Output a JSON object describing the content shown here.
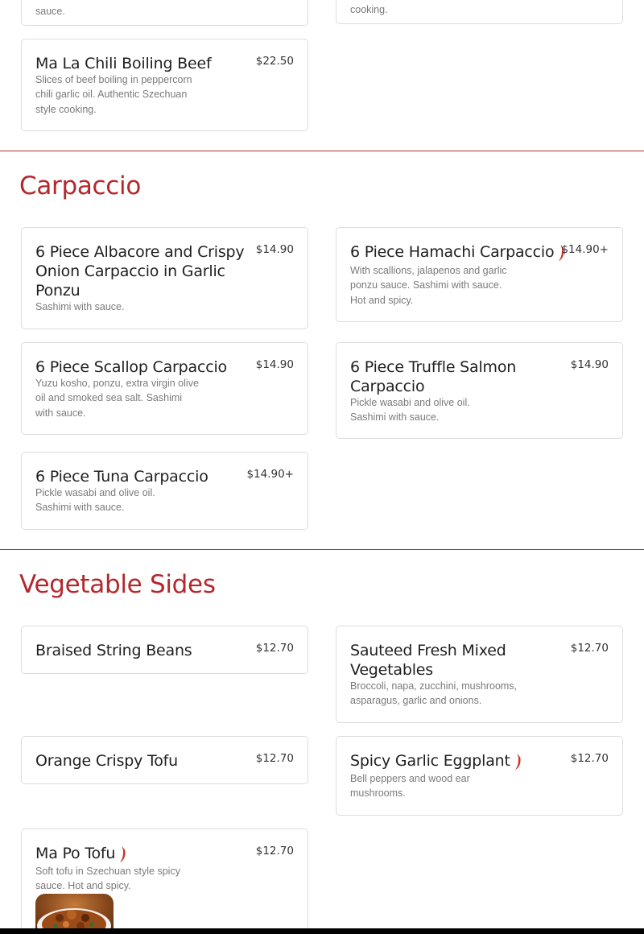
{
  "prev_section": {
    "left_partial_desc": "sauce.",
    "right_partial_desc": "cooking."
  },
  "items_top": {
    "ma_la_beef": {
      "name": "Ma La Chili Boiling Beef",
      "price": "$22.50",
      "desc": "Slices of beef boiling in peppercorn chili garlic oil. Authentic Szechuan style cooking."
    }
  },
  "carpaccio": {
    "title": "Carpaccio",
    "items": [
      {
        "name": "6 Piece Albacore and Crispy Onion Carpaccio in Garlic Ponzu",
        "price": "$14.90",
        "desc": "Sashimi with sauce."
      },
      {
        "name": "6 Piece Hamachi Carpaccio",
        "price": "$14.90+",
        "desc": "With scallions, jalapenos and garlic ponzu sauce. Sashimi with sauce. Hot and spicy."
      },
      {
        "name": "6 Piece Scallop Carpaccio",
        "price": "$14.90",
        "desc": "Yuzu kosho, ponzu, extra virgin olive oil and smoked sea salt. Sashimi with sauce."
      },
      {
        "name": "6 Piece Truffle Salmon Carpaccio",
        "price": "$14.90",
        "desc": "Pickle wasabi and olive oil. Sashimi with sauce."
      },
      {
        "name": "6 Piece Tuna Carpaccio",
        "price": "$14.90+",
        "desc": "Pickle wasabi and olive oil. Sashimi with sauce."
      }
    ]
  },
  "vegetable_sides": {
    "title": "Vegetable Sides",
    "items": [
      {
        "name": "Braised String Beans",
        "price": "$12.70",
        "desc": ""
      },
      {
        "name": "Sauteed Fresh Mixed Vegetables",
        "price": "$12.70",
        "desc": "Broccoli, napa, zucchini, mushrooms, asparagus, garlic and onions."
      },
      {
        "name": "Orange Crispy Tofu",
        "price": "$12.70",
        "desc": ""
      },
      {
        "name": "Spicy Garlic Eggplant",
        "price": "$12.70",
        "desc": "Bell peppers and wood ear mushrooms."
      },
      {
        "name": "Ma Po Tofu",
        "price": "$12.70",
        "desc": "Soft tofu in Szechuan style spicy sauce. Hot and spicy."
      }
    ]
  },
  "colors": {
    "accent": "#b3282d",
    "chili": "#c8372d"
  },
  "icons": {
    "spicy": "chili-pepper-icon"
  }
}
